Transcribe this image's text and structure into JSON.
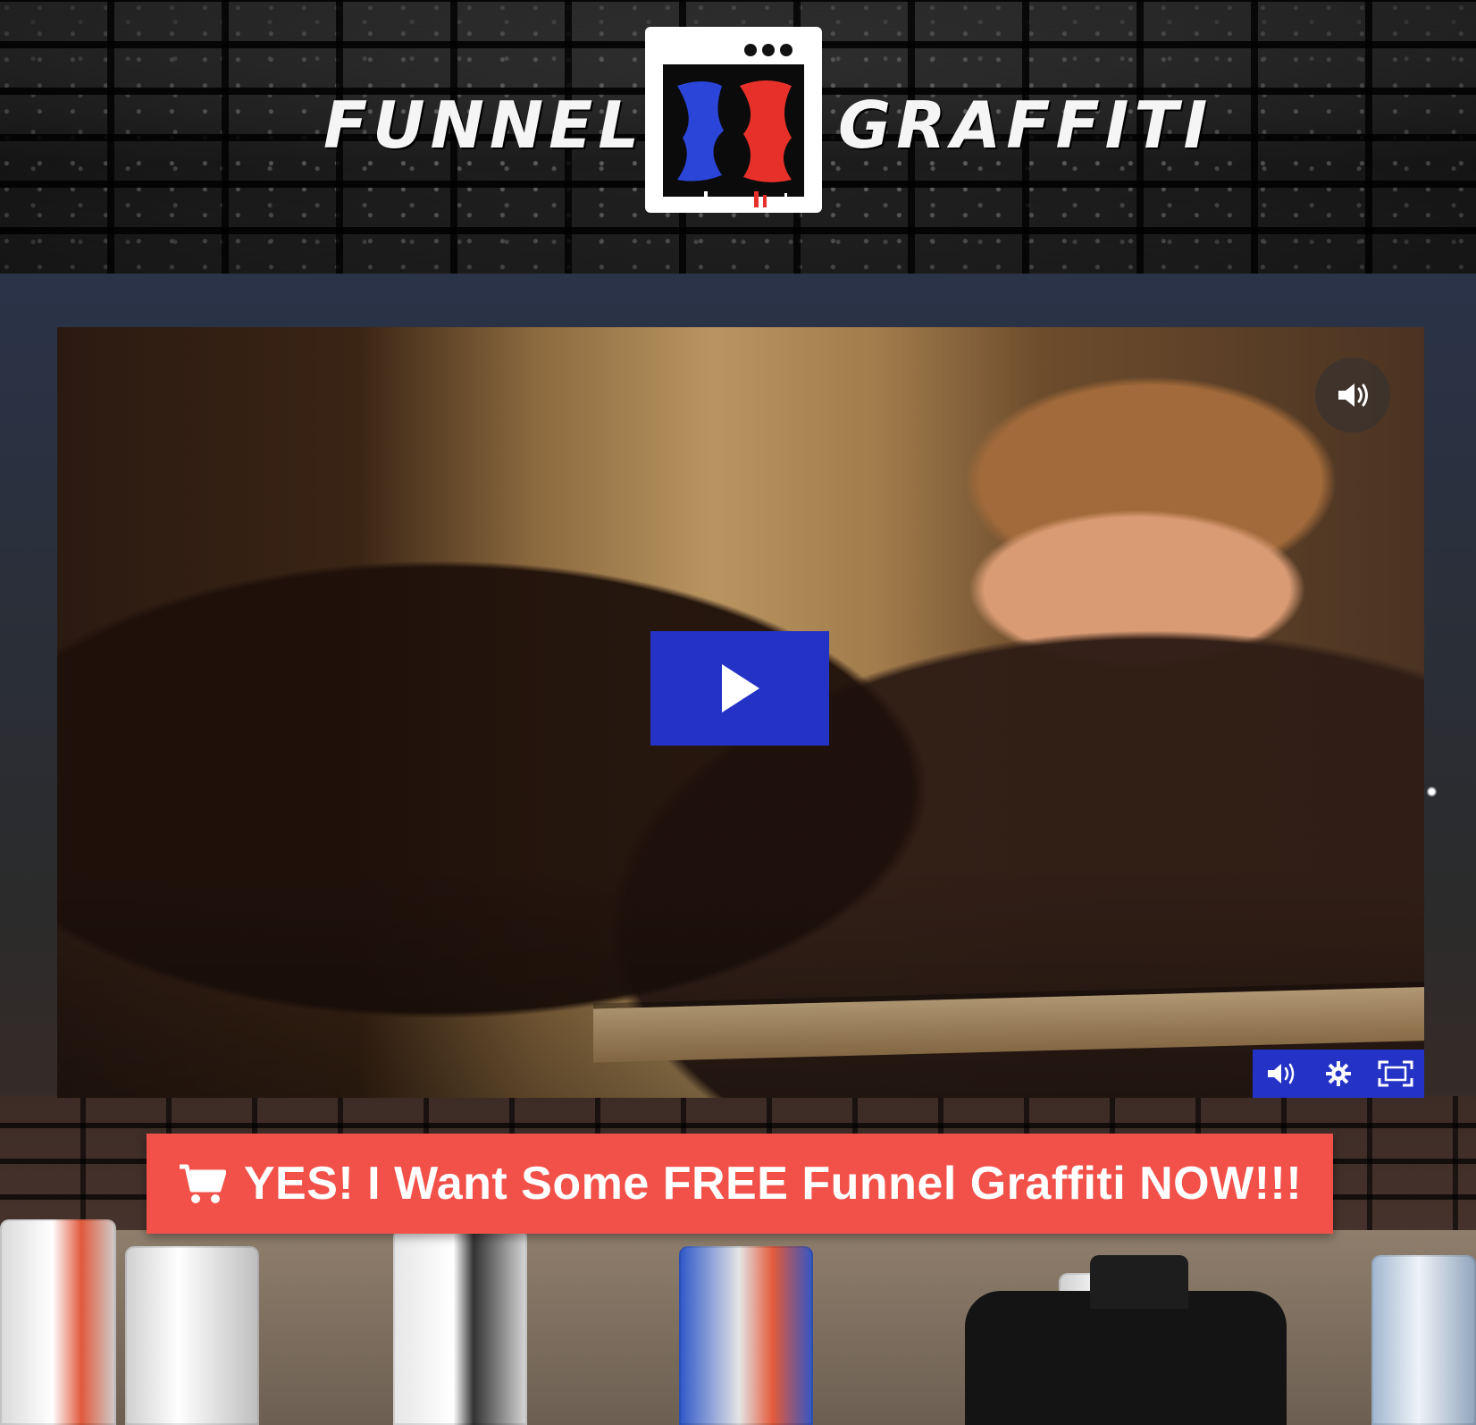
{
  "header": {
    "brand_left": "FUNNEL",
    "brand_right": "GRAFFITI",
    "logo_icon": "funnel-graffiti-logo-icon"
  },
  "video": {
    "play_icon": "play-icon",
    "sound_icon": "volume-icon",
    "controls": [
      {
        "name": "volume-icon"
      },
      {
        "name": "settings-gear-icon"
      },
      {
        "name": "fullscreen-icon"
      }
    ],
    "accent_color": "#2433c6"
  },
  "cta": {
    "label": "YES! I Want Some FREE Funnel Graffiti NOW!!!",
    "icon": "shopping-cart-icon",
    "color": "#f2514a"
  }
}
